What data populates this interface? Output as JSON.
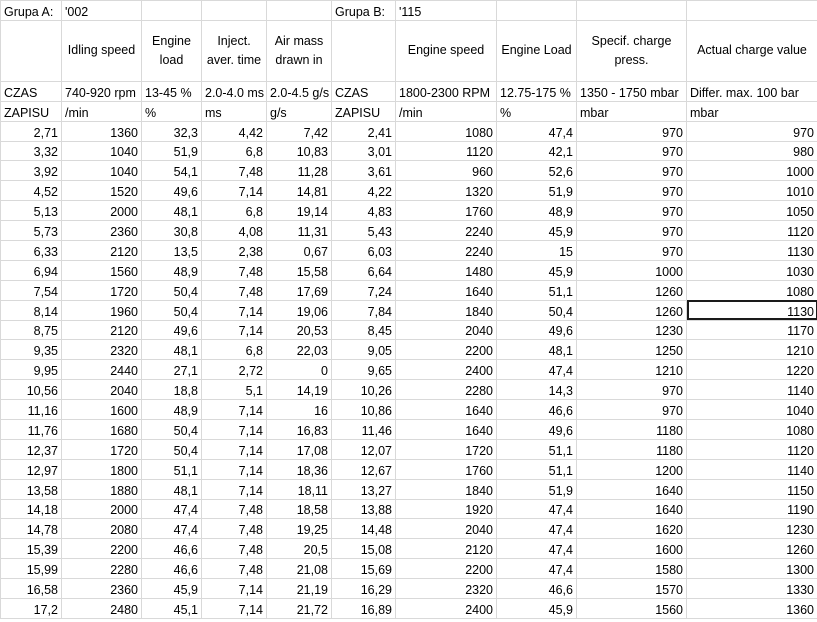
{
  "group_a": {
    "label": "Grupa A:",
    "code": "'002"
  },
  "group_b": {
    "label": "Grupa B:",
    "code": "'115"
  },
  "headers": [
    "",
    "Idling speed",
    "Engine load",
    "Inject. aver. time",
    "Air mass drawn in",
    "",
    "Engine speed",
    "Engine Load",
    "Specif. charge press.",
    "Actual charge value"
  ],
  "spec_row": [
    "CZAS",
    "740-920 rpm",
    "13-45 %",
    "2.0-4.0 ms",
    "2.0-4.5 g/s",
    "CZAS",
    "1800-2300 RPM",
    "12.75-175 %",
    "1350 - 1750 mbar",
    "Differ. max. 100 bar"
  ],
  "unit_row": [
    "ZAPISU",
    "/min",
    "%",
    "ms",
    "g/s",
    "ZAPISU",
    "/min",
    "%",
    "mbar",
    "mbar"
  ],
  "rows": [
    [
      "2,71",
      "1360",
      "32,3",
      "4,42",
      "7,42",
      "2,41",
      "1080",
      "47,4",
      "970",
      "970"
    ],
    [
      "3,32",
      "1040",
      "51,9",
      "6,8",
      "10,83",
      "3,01",
      "1120",
      "42,1",
      "970",
      "980"
    ],
    [
      "3,92",
      "1040",
      "54,1",
      "7,48",
      "11,28",
      "3,61",
      "960",
      "52,6",
      "970",
      "1000"
    ],
    [
      "4,52",
      "1520",
      "49,6",
      "7,14",
      "14,81",
      "4,22",
      "1320",
      "51,9",
      "970",
      "1010"
    ],
    [
      "5,13",
      "2000",
      "48,1",
      "6,8",
      "19,14",
      "4,83",
      "1760",
      "48,9",
      "970",
      "1050"
    ],
    [
      "5,73",
      "2360",
      "30,8",
      "4,08",
      "11,31",
      "5,43",
      "2240",
      "45,9",
      "970",
      "1120"
    ],
    [
      "6,33",
      "2120",
      "13,5",
      "2,38",
      "0,67",
      "6,03",
      "2240",
      "15",
      "970",
      "1130"
    ],
    [
      "6,94",
      "1560",
      "48,9",
      "7,48",
      "15,58",
      "6,64",
      "1480",
      "45,9",
      "1000",
      "1030"
    ],
    [
      "7,54",
      "1720",
      "50,4",
      "7,48",
      "17,69",
      "7,24",
      "1640",
      "51,1",
      "1260",
      "1080"
    ],
    [
      "8,14",
      "1960",
      "50,4",
      "7,14",
      "19,06",
      "7,84",
      "1840",
      "50,4",
      "1260",
      "1130"
    ],
    [
      "8,75",
      "2120",
      "49,6",
      "7,14",
      "20,53",
      "8,45",
      "2040",
      "49,6",
      "1230",
      "1170"
    ],
    [
      "9,35",
      "2320",
      "48,1",
      "6,8",
      "22,03",
      "9,05",
      "2200",
      "48,1",
      "1250",
      "1210"
    ],
    [
      "9,95",
      "2440",
      "27,1",
      "2,72",
      "0",
      "9,65",
      "2400",
      "47,4",
      "1210",
      "1220"
    ],
    [
      "10,56",
      "2040",
      "18,8",
      "5,1",
      "14,19",
      "10,26",
      "2280",
      "14,3",
      "970",
      "1140"
    ],
    [
      "11,16",
      "1600",
      "48,9",
      "7,14",
      "16",
      "10,86",
      "1640",
      "46,6",
      "970",
      "1040"
    ],
    [
      "11,76",
      "1680",
      "50,4",
      "7,14",
      "16,83",
      "11,46",
      "1640",
      "49,6",
      "1180",
      "1080"
    ],
    [
      "12,37",
      "1720",
      "50,4",
      "7,14",
      "17,08",
      "12,07",
      "1720",
      "51,1",
      "1180",
      "1120"
    ],
    [
      "12,97",
      "1800",
      "51,1",
      "7,14",
      "18,36",
      "12,67",
      "1760",
      "51,1",
      "1200",
      "1140"
    ],
    [
      "13,58",
      "1880",
      "48,1",
      "7,14",
      "18,11",
      "13,27",
      "1840",
      "51,9",
      "1640",
      "1150"
    ],
    [
      "14,18",
      "2000",
      "47,4",
      "7,48",
      "18,58",
      "13,88",
      "1920",
      "47,4",
      "1640",
      "1190"
    ],
    [
      "14,78",
      "2080",
      "47,4",
      "7,48",
      "19,25",
      "14,48",
      "2040",
      "47,4",
      "1620",
      "1230"
    ],
    [
      "15,39",
      "2200",
      "46,6",
      "7,48",
      "20,5",
      "15,08",
      "2120",
      "47,4",
      "1600",
      "1260"
    ],
    [
      "15,99",
      "2280",
      "46,6",
      "7,48",
      "21,08",
      "15,69",
      "2200",
      "47,4",
      "1580",
      "1300"
    ],
    [
      "16,58",
      "2360",
      "45,9",
      "7,14",
      "21,19",
      "16,29",
      "2320",
      "46,6",
      "1570",
      "1330"
    ],
    [
      "17,2",
      "2480",
      "45,1",
      "7,14",
      "21,72",
      "16,89",
      "2400",
      "45,9",
      "1560",
      "1360"
    ]
  ],
  "selected_cell": {
    "row": 9,
    "col": 9
  }
}
